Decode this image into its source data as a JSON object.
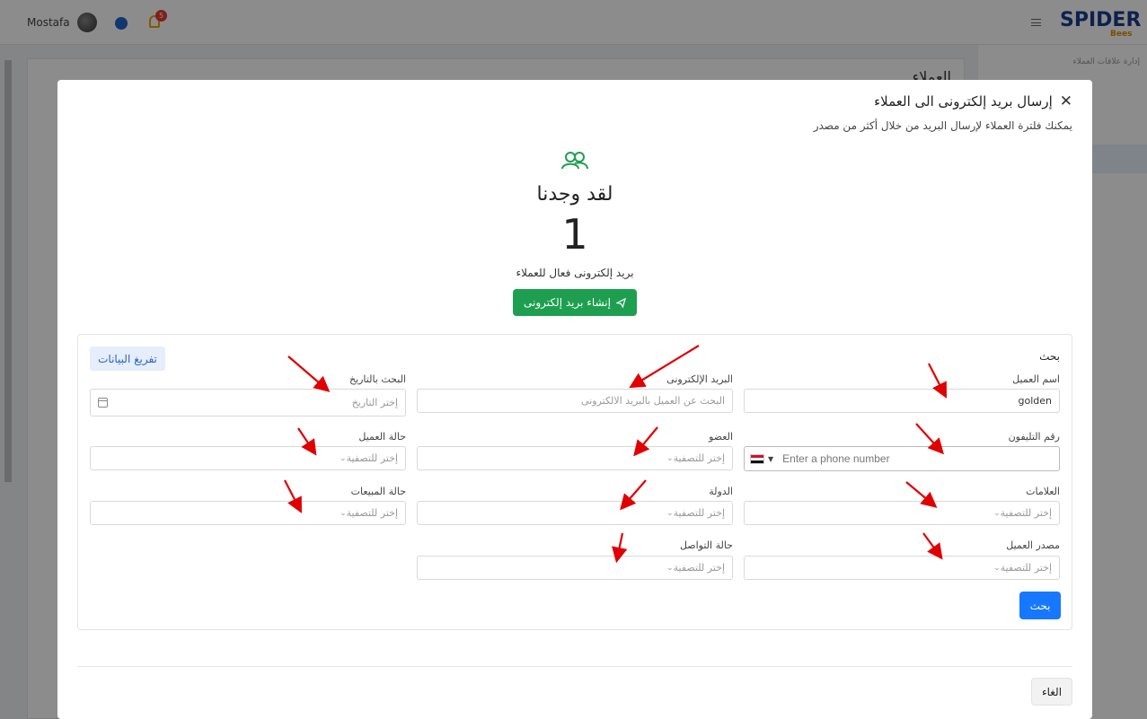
{
  "topbar": {
    "user_name": "Mostafa",
    "notification_count": "5",
    "logo_text": "SPIDER",
    "logo_sub": "Bees"
  },
  "sidebar": {
    "breadcrumb": "إدارة علاقات العملاء"
  },
  "background": {
    "page_title": "العملاء"
  },
  "modal": {
    "title": "إرسال بريد إلكترونى الى العملاء",
    "subtitle": "يمكنك فلترة العملاء لإرسال البريد من خلال أكثر من مصدر",
    "close_icon": "close-icon",
    "found_title": "لقد وجدنا",
    "found_count": "1",
    "found_desc": "بريد إلكترونى فعال للعملاء",
    "create_email_button": "إنشاء بريد إلكترونى",
    "search": {
      "heading": "بحث",
      "clear_button": "تفريغ البيانات",
      "customer_name": {
        "label": "اسم العميل",
        "value": "golden"
      },
      "email": {
        "label": "البريد الإلكترونى",
        "placeholder": "البحث عن العميل بالبريد الالكترونى"
      },
      "date": {
        "label": "البحث بالتاريخ",
        "placeholder": "إختر التاريخ"
      },
      "phone": {
        "label": "رقم التليفون",
        "placeholder": "Enter a phone number"
      },
      "member": {
        "label": "العضو",
        "placeholder": "إختر للتصفية"
      },
      "customer_status": {
        "label": "حالة العميل",
        "placeholder": "إختر للتصفية"
      },
      "tags": {
        "label": "العلامات",
        "placeholder": "إختر للتصفية"
      },
      "country": {
        "label": "الدولة",
        "placeholder": "إختر للتصفية"
      },
      "sales_status": {
        "label": "حالة المبيعات",
        "placeholder": "إختر للتصفية"
      },
      "customer_source": {
        "label": "مصدر العميل",
        "placeholder": "إختر للتصفية"
      },
      "contact_status": {
        "label": "حالة التواصل",
        "placeholder": "إختر للتصفية"
      },
      "search_button": "بحث"
    },
    "cancel_button": "الغاء"
  },
  "colors": {
    "green": "#1d9f4f",
    "primary": "#1677ff",
    "arrow": "#e00000"
  }
}
